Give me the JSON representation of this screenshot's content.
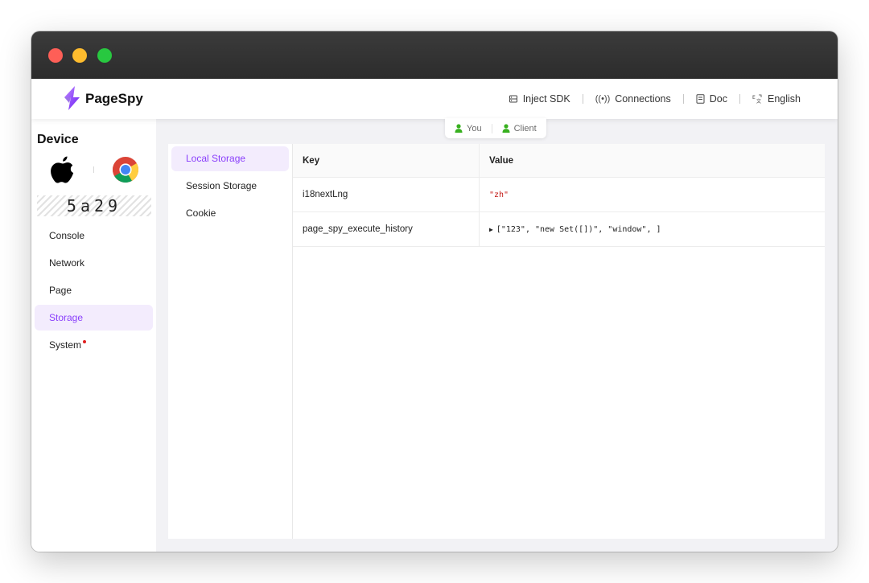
{
  "app": {
    "name": "PageSpy"
  },
  "nav": [
    {
      "label": "Inject SDK",
      "icon": "inject-sdk-icon"
    },
    {
      "label": "Connections",
      "icon": "connections-icon"
    },
    {
      "label": "Doc",
      "icon": "doc-icon"
    },
    {
      "label": "English",
      "icon": "language-icon"
    }
  ],
  "device": {
    "title": "Device",
    "os_icon": "apple-icon",
    "browser_icon": "chrome-icon",
    "code": "5a29"
  },
  "sidebar": {
    "items": [
      {
        "label": "Console"
      },
      {
        "label": "Network"
      },
      {
        "label": "Page"
      },
      {
        "label": "Storage",
        "active": true
      },
      {
        "label": "System",
        "has_dot": true
      }
    ]
  },
  "users": [
    {
      "label": "You",
      "icon": "user-icon"
    },
    {
      "label": "Client",
      "icon": "user-icon"
    }
  ],
  "storage": {
    "types": [
      {
        "label": "Local Storage",
        "active": true
      },
      {
        "label": "Session Storage"
      },
      {
        "label": "Cookie"
      }
    ],
    "columns": [
      "Key",
      "Value"
    ],
    "rows": [
      {
        "key": "i18nextLng",
        "value": "\"zh\""
      },
      {
        "key": "page_spy_execute_history",
        "value": "[\"123\", \"new Set([])\", \"window\", ]"
      }
    ]
  },
  "colors": {
    "accent": "#8a3ffc",
    "active_bg": "#f3ecfd",
    "user_green": "#38b01f",
    "string_red": "#c41a16",
    "titlebar": "#2c2c2c"
  }
}
